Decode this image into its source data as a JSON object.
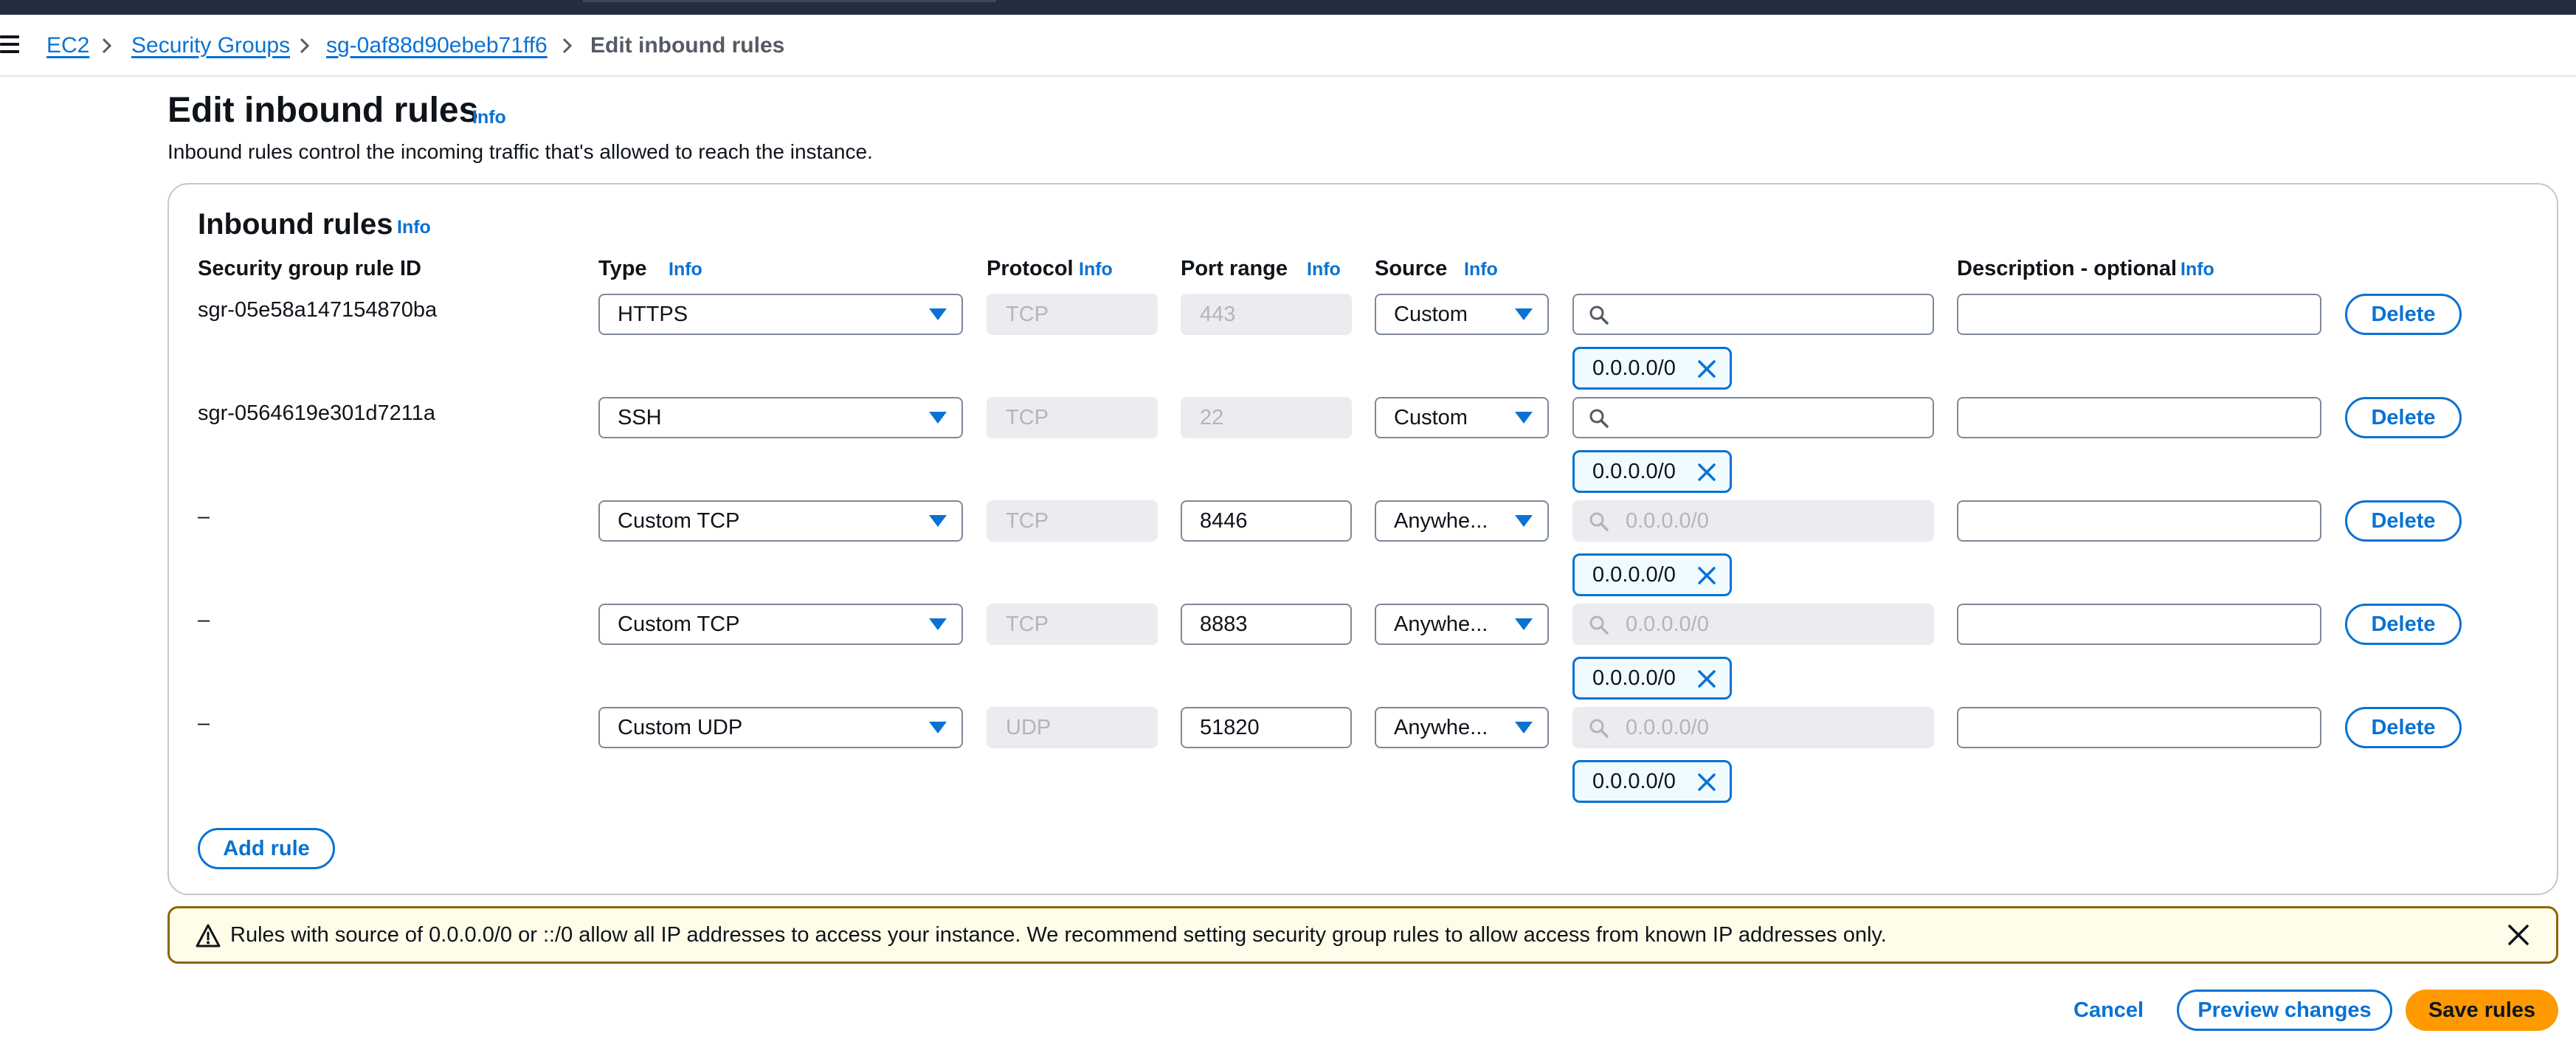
{
  "breadcrumb": {
    "items": [
      "EC2",
      "Security Groups",
      "sg-0af88d90ebeb71ff6",
      "Edit inbound rules"
    ]
  },
  "page": {
    "title": "Edit inbound rules",
    "info": "Info",
    "description": "Inbound rules control the incoming traffic that's allowed to reach the instance."
  },
  "panel": {
    "title": "Inbound rules",
    "info": "Info",
    "columns": {
      "rule_id": "Security group rule ID",
      "type": "Type",
      "protocol": "Protocol",
      "port_range": "Port range",
      "source": "Source",
      "description": "Description - optional",
      "info": "Info"
    }
  },
  "rules": [
    {
      "id": "sgr-05e58a147154870ba",
      "type": "HTTPS",
      "protocol": "TCP",
      "port": "443",
      "source": "Custom",
      "search_placeholder": "",
      "token": "0.0.0.0/0",
      "description": "",
      "delete": "Delete"
    },
    {
      "id": "sgr-0564619e301d7211a",
      "type": "SSH",
      "protocol": "TCP",
      "port": "22",
      "source": "Custom",
      "search_placeholder": "",
      "token": "0.0.0.0/0",
      "description": "",
      "delete": "Delete"
    },
    {
      "id": "–",
      "type": "Custom TCP",
      "protocol": "TCP",
      "port": "8446",
      "source": "Anywhe...",
      "search_placeholder": "0.0.0.0/0",
      "token": "0.0.0.0/0",
      "description": "",
      "delete": "Delete"
    },
    {
      "id": "–",
      "type": "Custom TCP",
      "protocol": "TCP",
      "port": "8883",
      "source": "Anywhe...",
      "search_placeholder": "0.0.0.0/0",
      "token": "0.0.0.0/0",
      "description": "",
      "delete": "Delete"
    },
    {
      "id": "–",
      "type": "Custom UDP",
      "protocol": "UDP",
      "port": "51820",
      "source": "Anywhe...",
      "search_placeholder": "0.0.0.0/0",
      "token": "0.0.0.0/0",
      "description": "",
      "delete": "Delete"
    }
  ],
  "add_rule": "Add rule",
  "alert": {
    "message": "Rules with source of 0.0.0.0/0 or ::/0 allow all IP addresses to access your instance. We recommend setting security group rules to allow access from known IP addresses only."
  },
  "footer": {
    "cancel": "Cancel",
    "preview": "Preview changes",
    "save": "Save rules"
  },
  "colors": {
    "accent": "#0972d3",
    "primary_button": "#ff9900",
    "warning_border": "#8d6605",
    "warning_bg": "#fffce9",
    "topbar": "#232f3e"
  },
  "icons": [
    "menu-icon",
    "chevron-right-icon",
    "caret-down-icon",
    "search-icon",
    "dismiss-icon",
    "warning-icon",
    "close-icon"
  ]
}
